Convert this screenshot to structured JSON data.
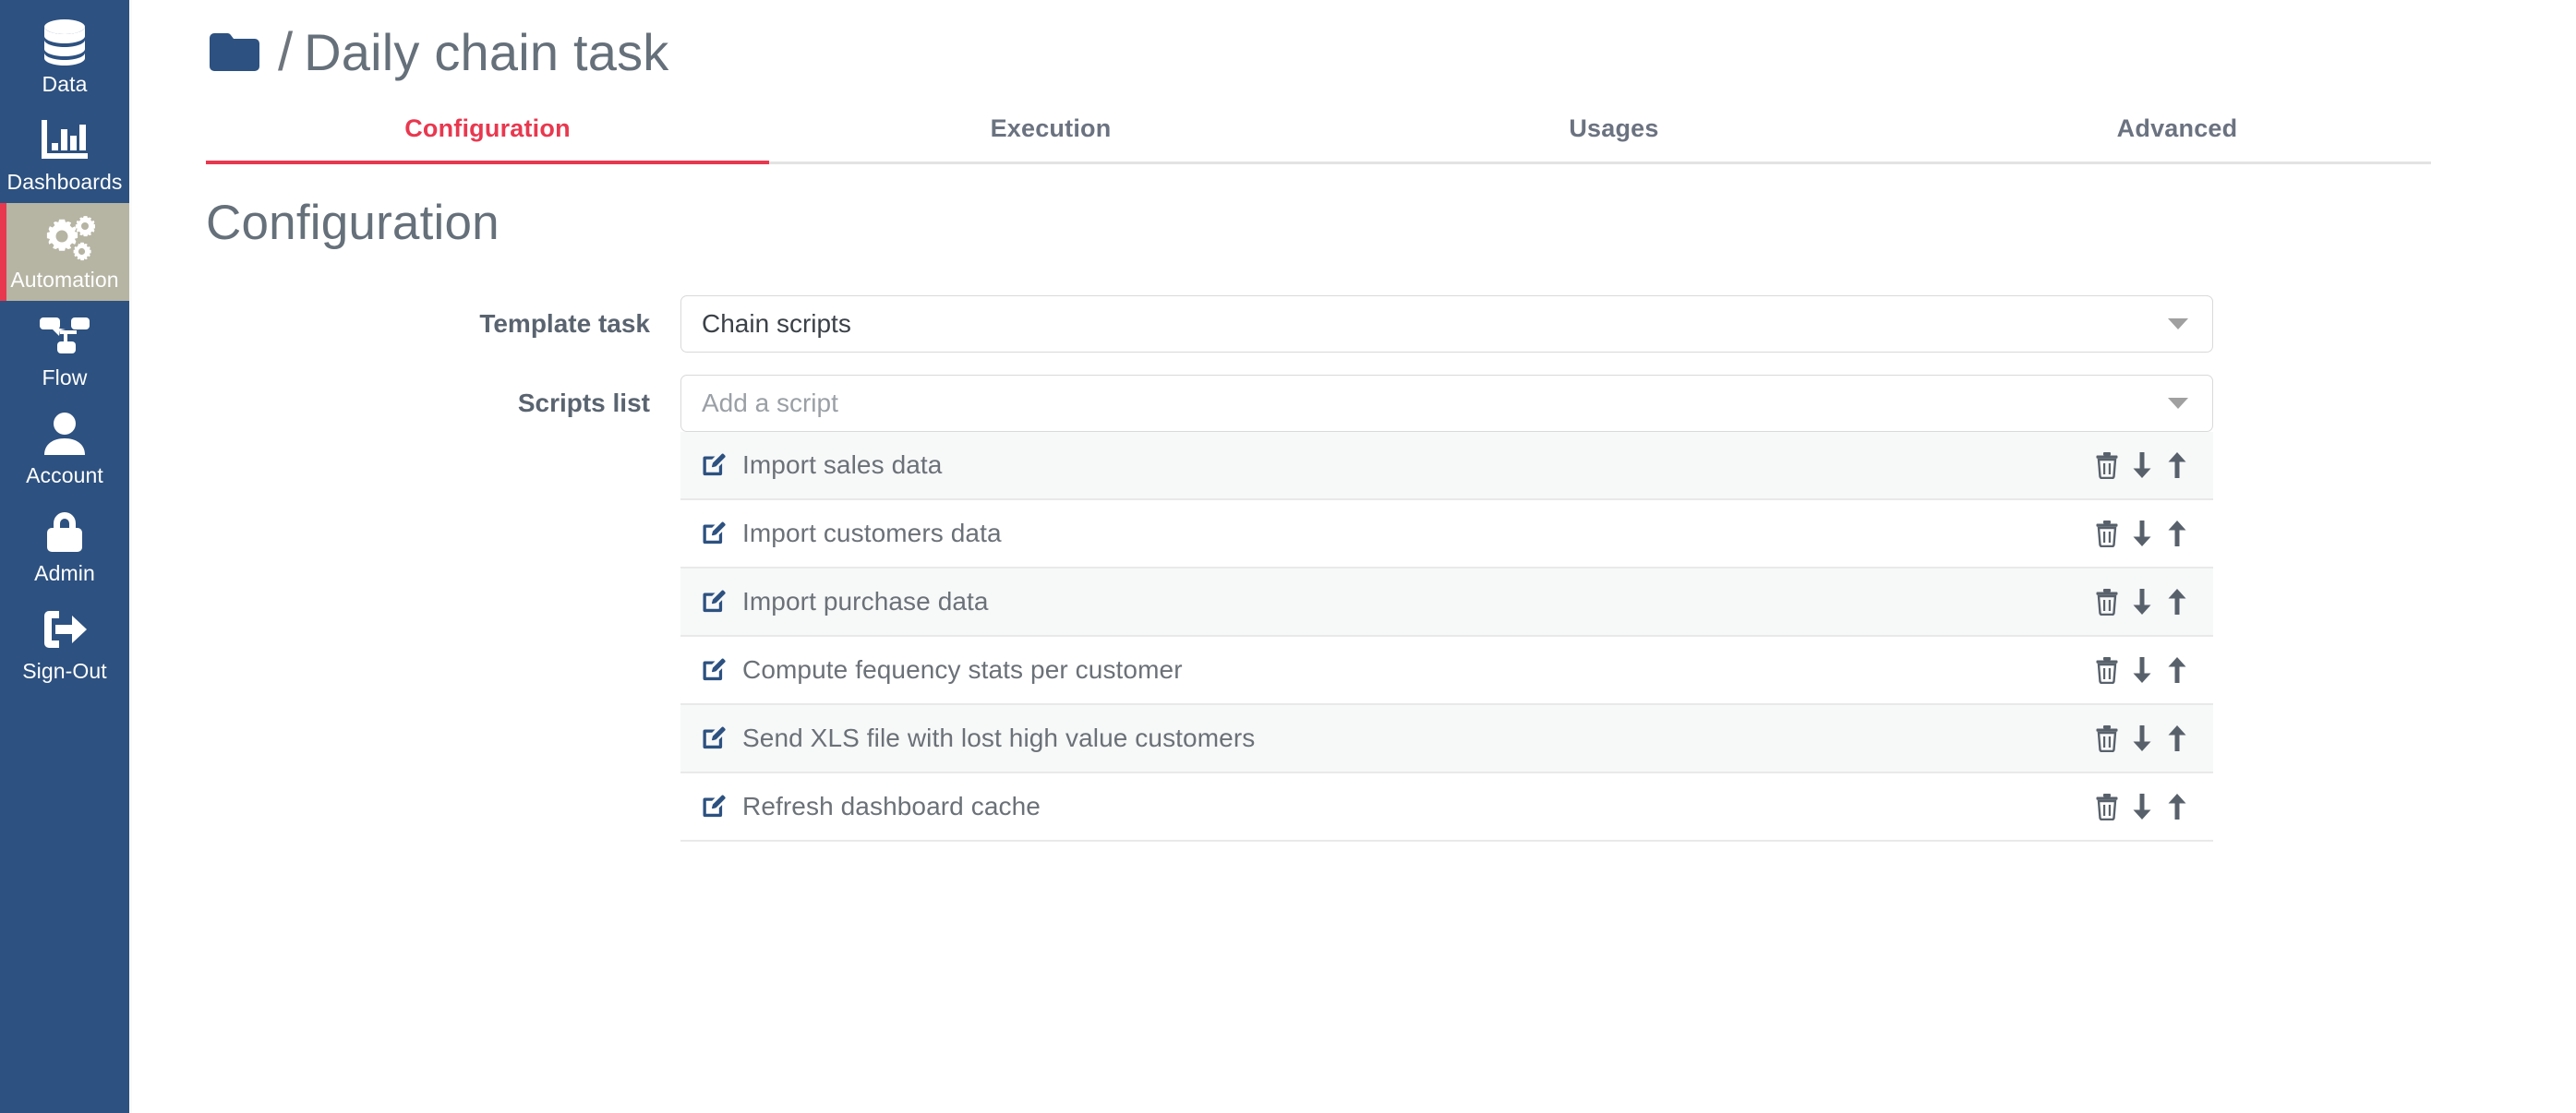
{
  "sidebar": {
    "background_color": "#2d5180",
    "active_background_color": "#b6b4a3",
    "active_accent_color": "#e8384f",
    "items": [
      {
        "label": "Data",
        "icon": "database-icon",
        "active": false
      },
      {
        "label": "Dashboards",
        "icon": "bar-chart-icon",
        "active": false
      },
      {
        "label": "Automation",
        "icon": "gears-icon",
        "active": true
      },
      {
        "label": "Flow",
        "icon": "flow-icon",
        "active": false
      },
      {
        "label": "Account",
        "icon": "user-icon",
        "active": false
      },
      {
        "label": "Admin",
        "icon": "lock-icon",
        "active": false
      },
      {
        "label": "Sign-Out",
        "icon": "sign-out-icon",
        "active": false
      }
    ]
  },
  "header": {
    "folder_icon": "folder-icon",
    "separator": "/",
    "title": "Daily chain task",
    "folder_color": "#2d5180",
    "title_color": "#66707a"
  },
  "tabs": {
    "active_color": "#e8384f",
    "items": [
      {
        "label": "Configuration",
        "active": true
      },
      {
        "label": "Execution",
        "active": false
      },
      {
        "label": "Usages",
        "active": false
      },
      {
        "label": "Advanced",
        "active": false
      }
    ]
  },
  "main": {
    "section_title": "Configuration",
    "form": {
      "template_task": {
        "label": "Template task",
        "value": "Chain scripts",
        "caret_icon": "chevron-down-icon"
      },
      "scripts_list": {
        "label": "Scripts list",
        "placeholder": "Add a script",
        "value": "",
        "caret_icon": "chevron-down-icon"
      }
    },
    "scripts": [
      {
        "name": "Import sales data",
        "edit_icon": "edit-pencil-icon",
        "delete_icon": "trash-icon",
        "move_down_icon": "arrow-down-icon",
        "move_up_icon": "arrow-up-icon"
      },
      {
        "name": "Import customers data",
        "edit_icon": "edit-pencil-icon",
        "delete_icon": "trash-icon",
        "move_down_icon": "arrow-down-icon",
        "move_up_icon": "arrow-up-icon"
      },
      {
        "name": "Import purchase data",
        "edit_icon": "edit-pencil-icon",
        "delete_icon": "trash-icon",
        "move_down_icon": "arrow-down-icon",
        "move_up_icon": "arrow-up-icon"
      },
      {
        "name": "Compute fequency stats per customer",
        "edit_icon": "edit-pencil-icon",
        "delete_icon": "trash-icon",
        "move_down_icon": "arrow-down-icon",
        "move_up_icon": "arrow-up-icon"
      },
      {
        "name": "Send XLS file with lost high value customers",
        "edit_icon": "edit-pencil-icon",
        "delete_icon": "trash-icon",
        "move_down_icon": "arrow-down-icon",
        "move_up_icon": "arrow-up-icon"
      },
      {
        "name": "Refresh dashboard cache",
        "edit_icon": "edit-pencil-icon",
        "delete_icon": "trash-icon",
        "move_down_icon": "arrow-down-icon",
        "move_up_icon": "arrow-up-icon"
      }
    ]
  }
}
